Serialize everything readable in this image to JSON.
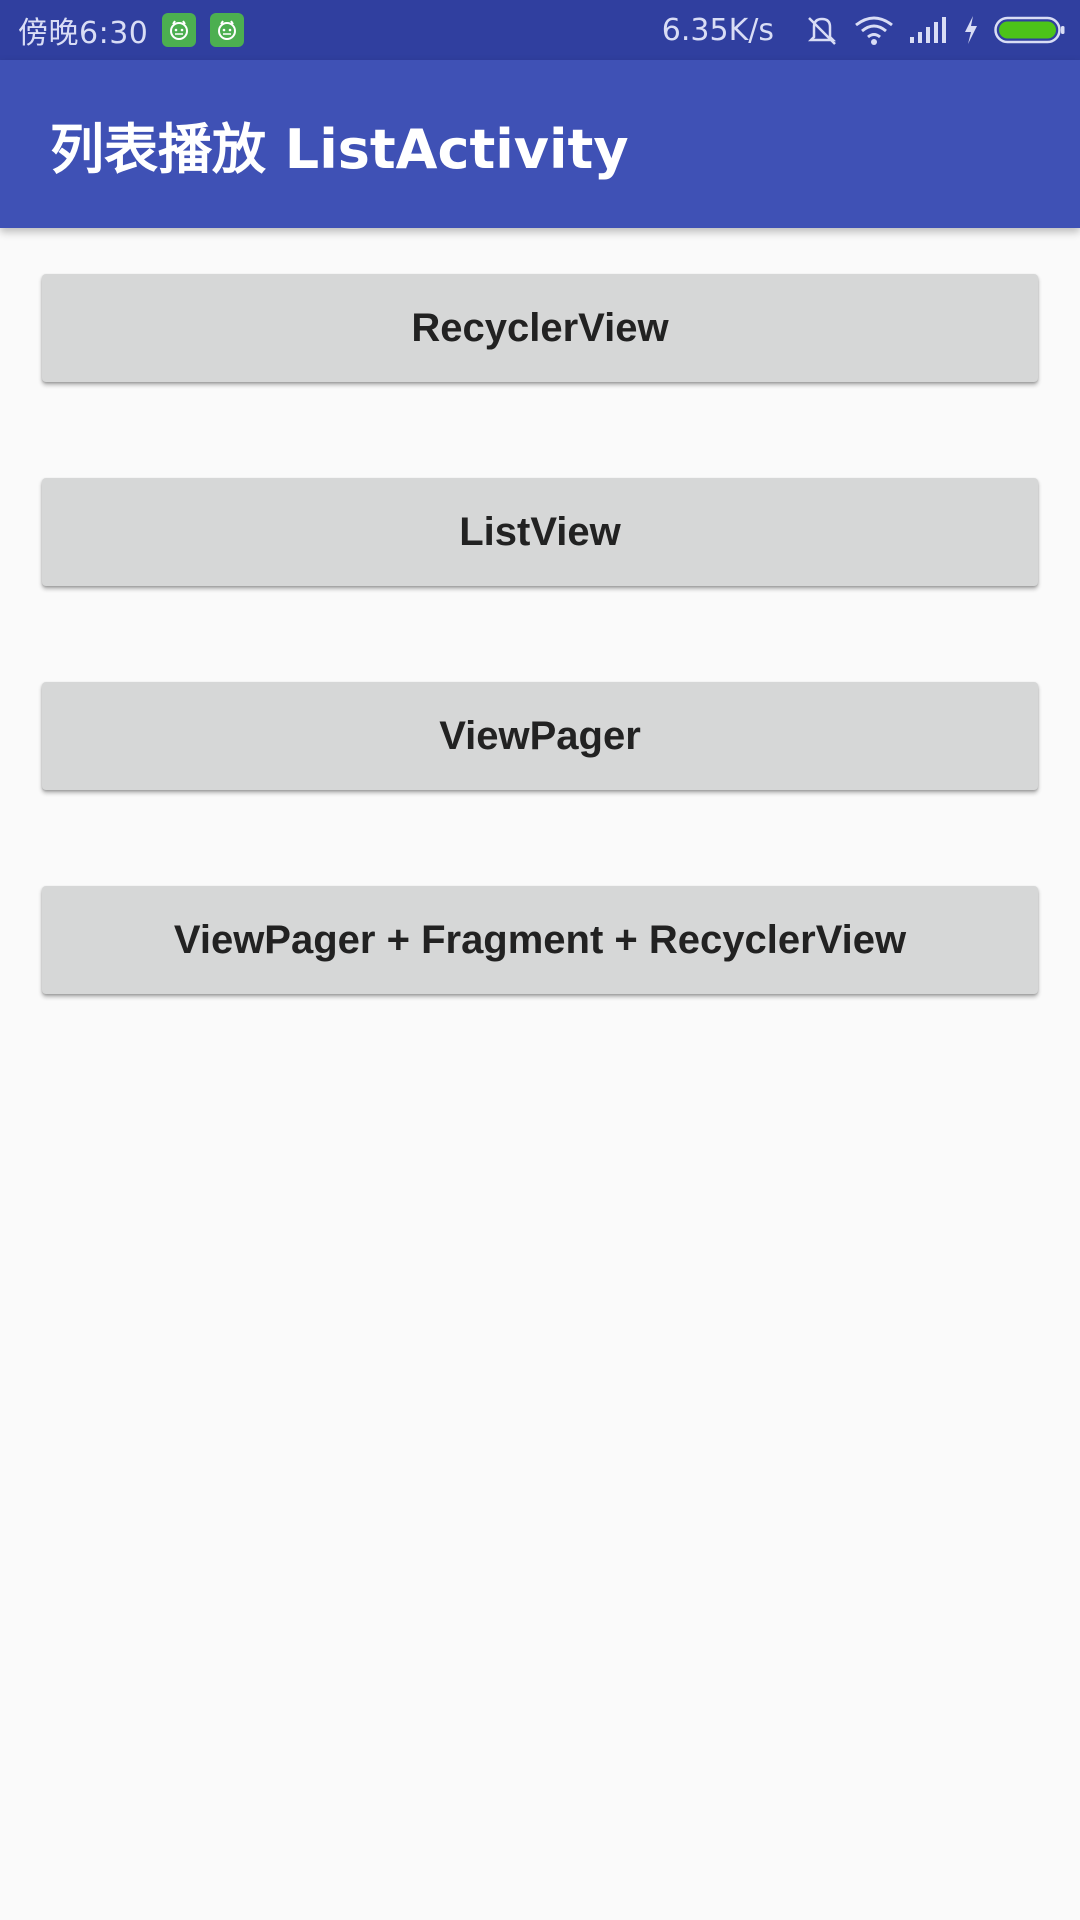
{
  "status_bar": {
    "time": "傍晚6:30",
    "notification_icons": [
      "app-notification-icon",
      "app-notification-icon"
    ],
    "net_speed": "6.35K/s",
    "icons": [
      "mute-icon",
      "wifi-icon",
      "signal-icon",
      "charging-icon",
      "battery-icon"
    ],
    "battery_color": "#4cc319"
  },
  "app_bar": {
    "title": "列表播放 ListActivity",
    "color": "#3f51b5"
  },
  "buttons": [
    {
      "label": "RecyclerView"
    },
    {
      "label": "ListView"
    },
    {
      "label": "ViewPager"
    },
    {
      "label": "ViewPager + Fragment + RecyclerView"
    }
  ]
}
